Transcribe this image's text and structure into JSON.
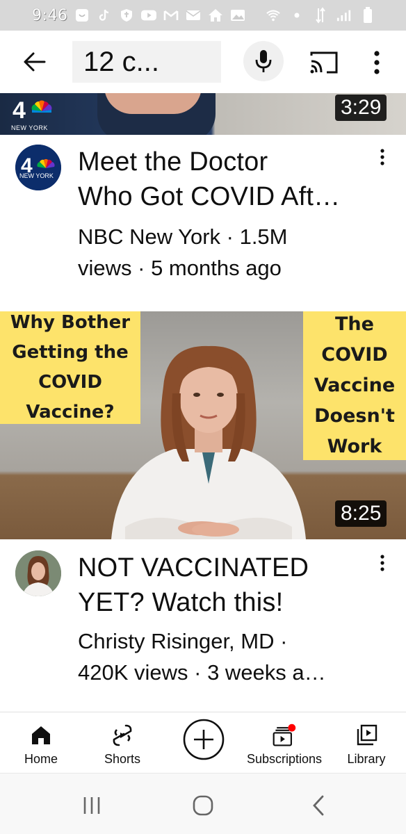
{
  "status_bar": {
    "time": "9:46",
    "icons": [
      "ghost-icon",
      "tiktok-icon",
      "shield-icon",
      "youtube-icon",
      "gmail-icon",
      "mail-icon",
      "home-icon",
      "photo-icon",
      "wifi-icon",
      "dot-icon",
      "data-arrows-icon",
      "signal-icon",
      "battery-icon"
    ]
  },
  "search_header": {
    "query": "12 c...",
    "icons": [
      "back-arrow-icon",
      "clear-x-icon",
      "mic-icon",
      "cast-icon",
      "more-vertical-icon"
    ]
  },
  "videos": [
    {
      "thumbnail_logo_text": "NEW YORK",
      "thumbnail_logo_number": "4",
      "duration": "3:29",
      "avatar_label": "NEW YORK",
      "title_line1": "Meet the Doctor",
      "title_line2": "Who Got COVID Aft…",
      "meta_line1": "NBC New York · 1.5M",
      "meta_line2": "views · 5 months ago"
    },
    {
      "thumbnail_left_text": [
        "Why Bother",
        "Getting the",
        "COVID",
        "Vaccine?"
      ],
      "thumbnail_right_text": [
        "The",
        "COVID",
        "Vaccine",
        "Doesn't",
        "Work"
      ],
      "duration": "8:25",
      "title_line1": "NOT VACCINATED",
      "title_line2": "YET? Watch this!",
      "meta_line1": "Christy Risinger, MD ·",
      "meta_line2": "420K views · 3 weeks a…"
    }
  ],
  "bottom_nav": {
    "items": [
      {
        "label": "Home",
        "icon": "home-icon"
      },
      {
        "label": "Shorts",
        "icon": "shorts-icon"
      },
      {
        "label": "",
        "icon": "create-plus-icon"
      },
      {
        "label": "Subscriptions",
        "icon": "subscriptions-icon"
      },
      {
        "label": "Library",
        "icon": "library-icon"
      }
    ]
  },
  "android_nav": {
    "icons": [
      "recents-icon",
      "home-circle-icon",
      "back-chevron-icon"
    ]
  },
  "colors": {
    "thumbnail_yellow": "#fde36b",
    "notification_dot": "#ff0000",
    "status_bar_bg": "#d8d8d8"
  }
}
